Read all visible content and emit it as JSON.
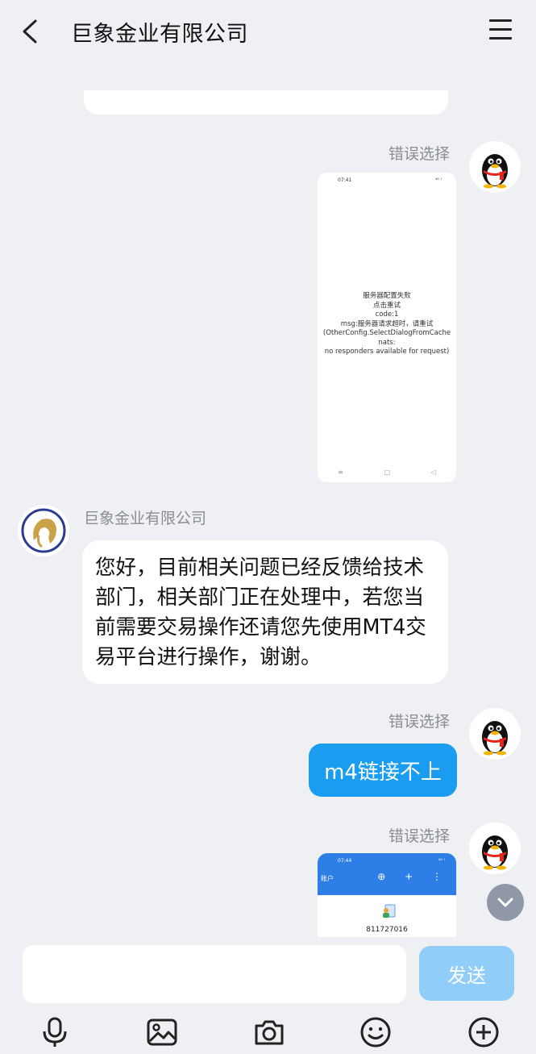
{
  "header": {
    "title": "巨象金业有限公司",
    "back_icon": "chevron-left-icon",
    "menu_icon": "menu-icon"
  },
  "messages": [
    {
      "side": "right",
      "sender": "错误选择",
      "type": "image",
      "image": {
        "time": "07:41",
        "status": "⁴ᴳ ᴵ",
        "lines": [
          "服务器配置失败",
          "点击重试",
          "code:1",
          "msg:服务器请求超时，请重试",
          "(OtherConfig.SelectDialogFromCache nats:",
          "no responders available for request)"
        ],
        "nav": [
          "≡",
          "□",
          "◁"
        ]
      }
    },
    {
      "side": "left",
      "sender": "巨象金业有限公司",
      "type": "text",
      "text": "您好，目前相关问题已经反馈给技术部门，相关部门正在处理中，若您当前需要交易操作还请您先使用MT4交易平台进行操作，谢谢。"
    },
    {
      "side": "right",
      "sender": "错误选择",
      "type": "text",
      "text": "m4链接不上"
    },
    {
      "side": "right",
      "sender": "错误选择",
      "type": "image",
      "image": {
        "time": "07:44",
        "status": "⁴ᴳ ᴵ",
        "header_title": "账户",
        "icons": "⊕ + ⋮",
        "account": "811727016"
      }
    }
  ],
  "composer": {
    "placeholder": "",
    "send_label": "发送"
  },
  "toolbar": [
    "microphone-icon",
    "image-icon",
    "camera-icon",
    "emoji-icon",
    "add-icon"
  ],
  "colors": {
    "background": "#eef0f4",
    "my_bubble": "#1a9cf0",
    "send_button": "#90cdf8"
  }
}
